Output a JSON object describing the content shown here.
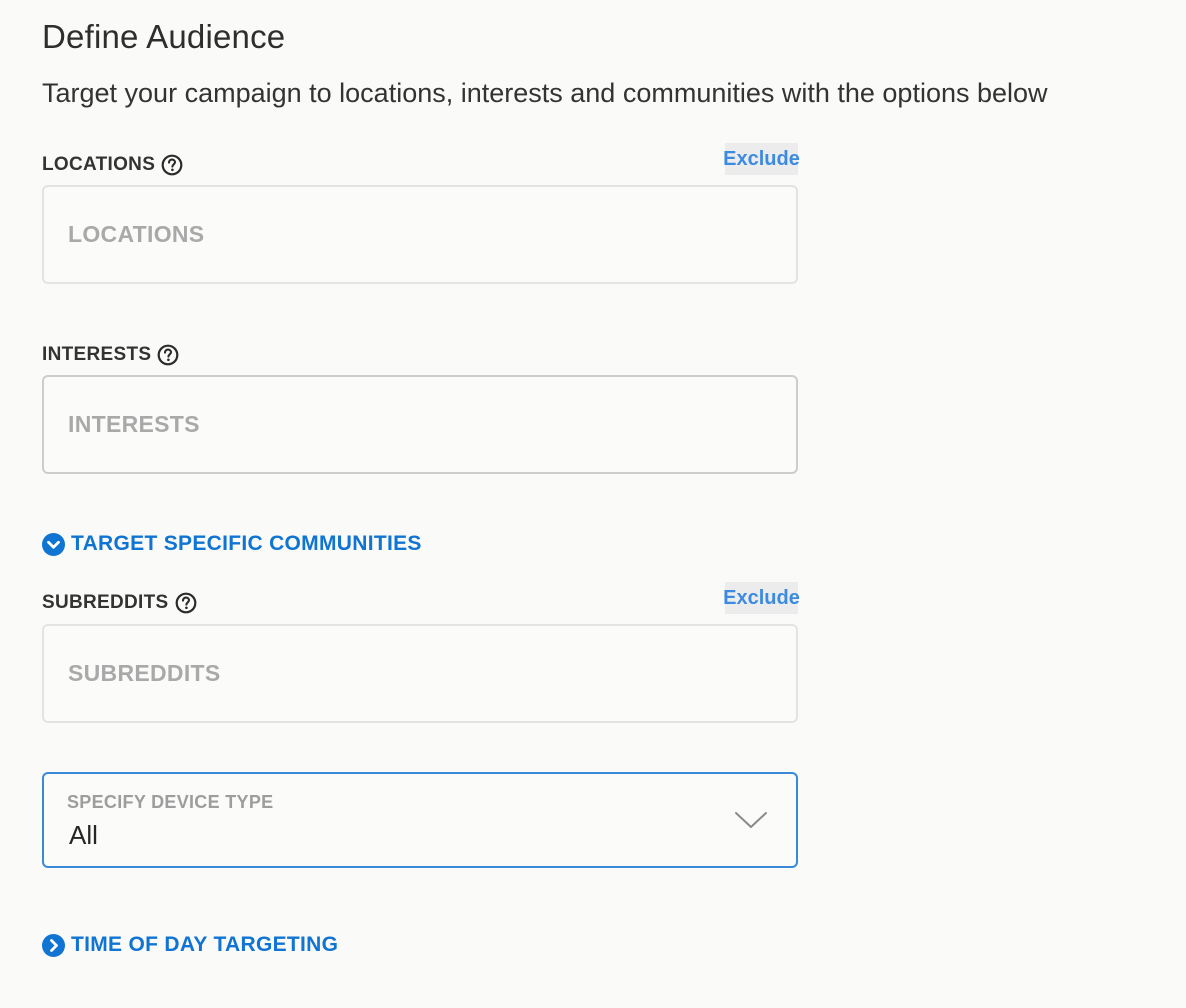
{
  "header": {
    "title": "Define Audience",
    "subtitle": "Target your campaign to locations, interests and communities with the options below"
  },
  "locations": {
    "label": "LOCATIONS",
    "placeholder": "LOCATIONS",
    "exclude_label": "Exclude",
    "help_icon": "question-circle-icon"
  },
  "interests": {
    "label": "INTERESTS",
    "placeholder": "INTERESTS",
    "help_icon": "question-circle-icon"
  },
  "communities_toggle": {
    "label": "TARGET SPECIFIC COMMUNITIES",
    "icon": "chevron-down-circle-icon",
    "expanded": true
  },
  "subreddits": {
    "label": "SUBREDDITS",
    "placeholder": "SUBREDDITS",
    "exclude_label": "Exclude",
    "help_icon": "question-circle-icon"
  },
  "device_type": {
    "caption": "SPECIFY DEVICE TYPE",
    "selected": "All",
    "icon": "chevron-down-icon"
  },
  "time_of_day_toggle": {
    "label": "TIME OF DAY TARGETING",
    "icon": "chevron-right-circle-icon",
    "expanded": false
  },
  "colors": {
    "link_blue": "#0f74d2",
    "exclude_blue": "#3d8be0",
    "focus_border": "#3a8ad6",
    "placeholder_gray": "#a9a9a9"
  }
}
